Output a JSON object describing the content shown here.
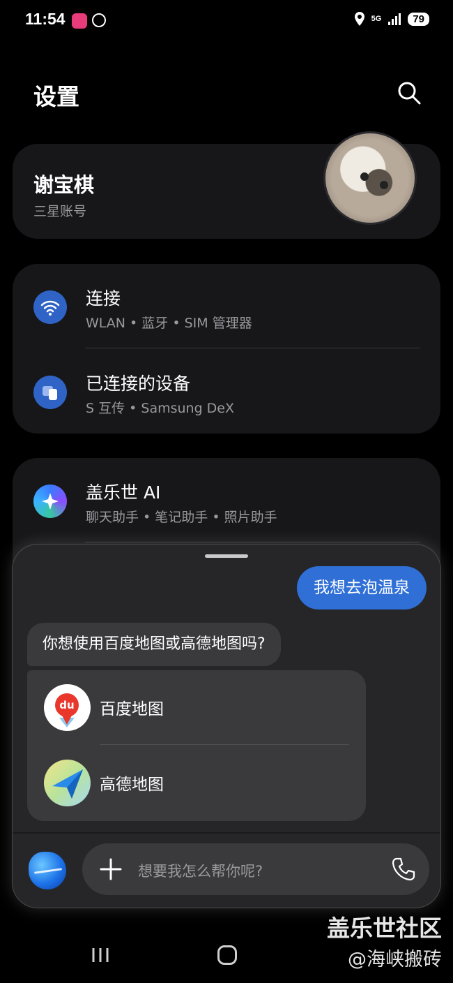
{
  "status_bar": {
    "time": "11:54",
    "network": "5G",
    "battery": "79"
  },
  "header": {
    "title": "设置"
  },
  "account": {
    "name": "谢宝棋",
    "subtitle": "三星账号"
  },
  "settings_groups": [
    {
      "items": [
        {
          "label": "连接",
          "description": "WLAN • 蓝牙 • SIM 管理器",
          "icon": "wifi-icon"
        },
        {
          "label": "已连接的设备",
          "description": "S 互传 • Samsung DeX",
          "icon": "connected-devices-icon"
        }
      ]
    },
    {
      "items": [
        {
          "label": "盖乐世 AI",
          "description": "聊天助手 • 笔记助手 • 照片助手",
          "icon": "sparkle-icon"
        }
      ]
    }
  ],
  "assistant": {
    "user_message": "我想去泡温泉",
    "bot_message": "你想使用百度地图或高德地图吗?",
    "options": [
      {
        "label": "百度地图",
        "icon": "baidu-maps-icon"
      },
      {
        "label": "高德地图",
        "icon": "amap-icon"
      }
    ],
    "input_placeholder": "想要我怎么帮你呢?"
  },
  "watermark": {
    "line1": "盖乐世社区",
    "line2": "@海峡搬砖"
  },
  "colors": {
    "background": "#000000",
    "card": "#17171a",
    "accent_blue": "#2f6fd6",
    "sheet": "#262628"
  }
}
